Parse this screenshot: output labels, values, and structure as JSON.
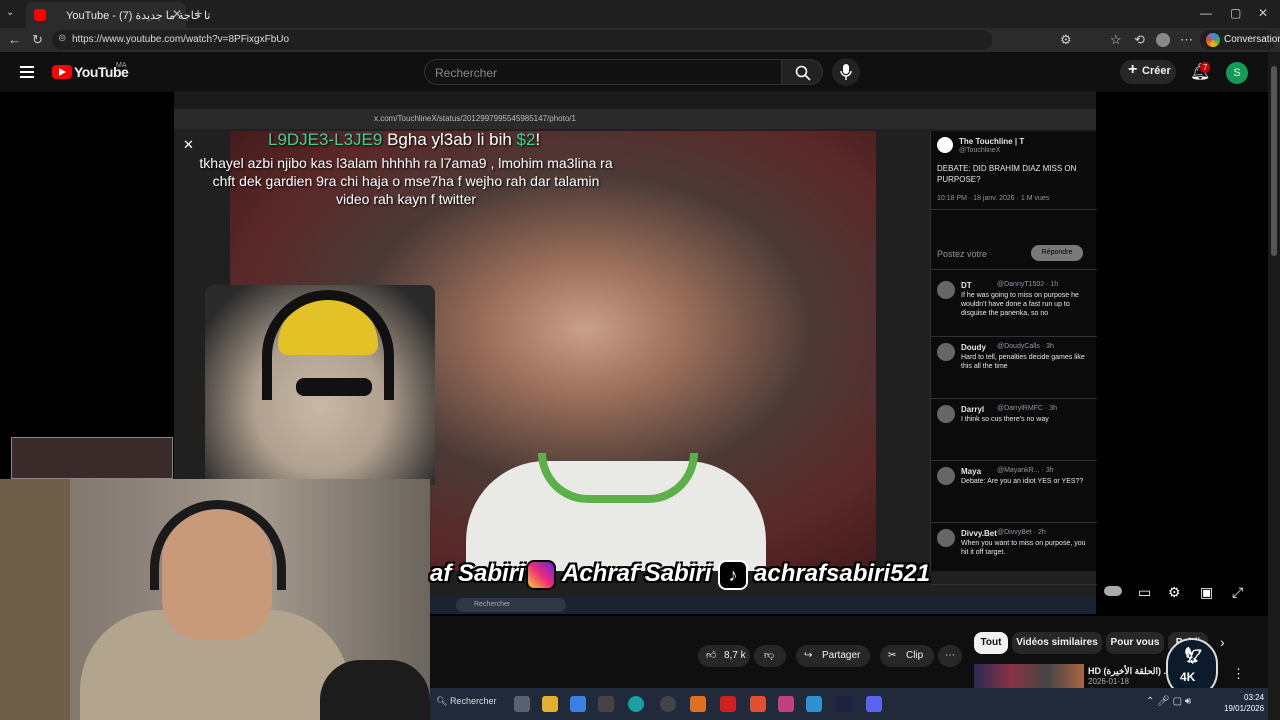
{
  "browser": {
    "tab_title": "YouTube - (7) تا حاجة ما جديدة",
    "url": "https://www.youtube.com/watch?v=8PFixgxFbUo",
    "conversation_label": "Conversation"
  },
  "youtube": {
    "logo_text": "YouTube",
    "country": "MA",
    "search_placeholder": "Rechercher",
    "create_label": "Créer",
    "notif_count": "7",
    "avatar_initial": "S"
  },
  "video": {
    "inner_url": "x.com/TouchlineX/status/2012997995545985147/photo/1",
    "alert_user": "L9DJE3-L3JE9",
    "alert_mid": " Bgha yl3ab li bih ",
    "alert_amount": "$2",
    "alert_end": "!",
    "alert_message": "tkhayel azbi njibo kas l3alam hhhhh ra l7ama9 , lmohim ma3lina ra chft dek gardien 9ra chi haja o mse7ha f wejho rah dar talamin video rah kayn f twitter",
    "banner_name1": "af Sabiri",
    "banner_name2": "Achraf Sabiri",
    "banner_tiktok": "achrafsabiri521",
    "inner_search": "Rechercher",
    "tweet": {
      "author": "The Touchline | T",
      "handle": "@TouchlineX",
      "text": "DEBATE: DID BRAHIM DIAZ MISS ON PURPOSE?",
      "meta": "10:18 PM · 18 janv. 2026 · 1 M vues",
      "reply_placeholder": "Postez votre",
      "reply_button": "Répondre",
      "replies": [
        {
          "name": "DT",
          "handle": "@DannyT1502 · 1h",
          "text": "If he was going to miss on purpose he wouldn't have done a fast run up to disguise the panenka, so no"
        },
        {
          "name": "Doudy",
          "handle": "@DoudyCalls · 3h",
          "text": "Hard to tell, penalties decide games like this all the time"
        },
        {
          "name": "Darryl",
          "handle": "@DarrylRMFC · 3h",
          "text": "I think so cus there's no way"
        },
        {
          "name": "Maya",
          "handle": "@MayankR... · 3h",
          "text": "Debate: Are you an idiot YES or YES??"
        },
        {
          "name": "Divvy.Bet",
          "handle": "@DivvyBet · 2h",
          "text": "When you want to miss on purpose, you hit it off target."
        }
      ]
    }
  },
  "actions": {
    "likes": "8,7 k",
    "share": "Partager",
    "clip": "Clip"
  },
  "chips": [
    "Tout",
    "Vidéos similaires",
    "Pour vous",
    "Publi"
  ],
  "suggestion": {
    "title": "HD (الحلقة الأخيرة) ...",
    "date": "2026-01-18"
  },
  "logo4k": "4K",
  "taskbar": {
    "search": "Rechercher",
    "time": "03:24",
    "date": "19/01/2026"
  }
}
